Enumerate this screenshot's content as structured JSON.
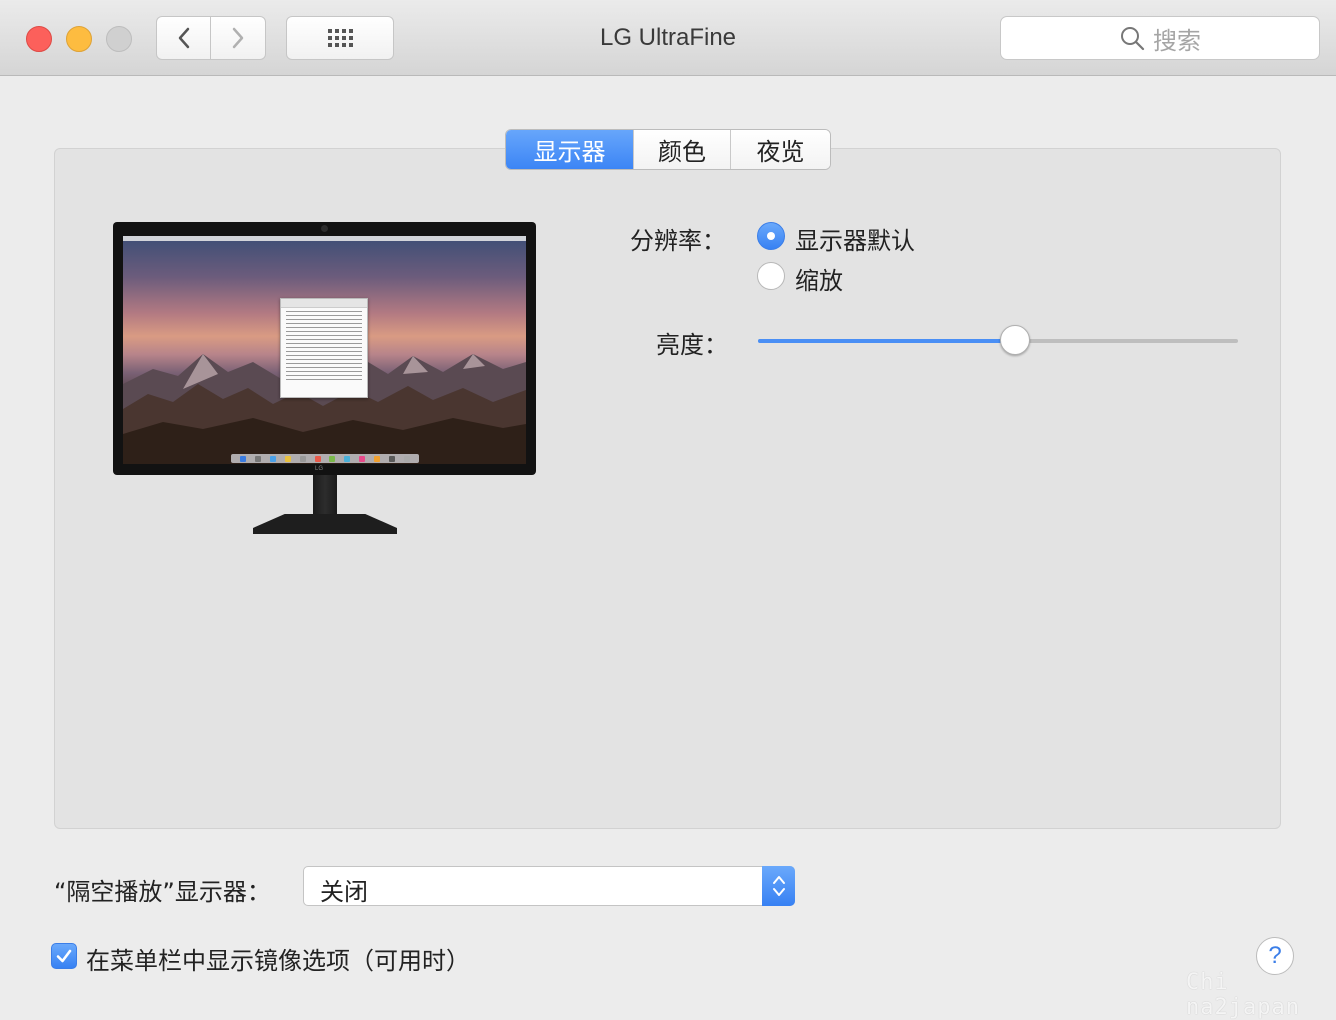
{
  "window": {
    "title": "LG UltraFine",
    "search_placeholder": "搜索"
  },
  "tabs": [
    {
      "label": "显示器",
      "active": true
    },
    {
      "label": "颜色",
      "active": false
    },
    {
      "label": "夜览",
      "active": false
    }
  ],
  "resolution": {
    "label": "分辨率：",
    "options": [
      {
        "label": "显示器默认",
        "selected": true
      },
      {
        "label": "缩放",
        "selected": false
      }
    ]
  },
  "brightness": {
    "label": "亮度：",
    "value": 0.535
  },
  "airplay": {
    "label": "“隔空播放”显示器：",
    "selected": "关闭"
  },
  "mirroring": {
    "label": "在菜单栏中显示镜像选项（可用时）",
    "checked": true
  },
  "help_label": "?",
  "watermark": "Chi na2japan",
  "monitor_logo": "LG",
  "colors": {
    "accent": "#3c85f5",
    "close": "#fc605b",
    "minimize": "#fdbc40",
    "zoom": "#d0d0d0"
  }
}
